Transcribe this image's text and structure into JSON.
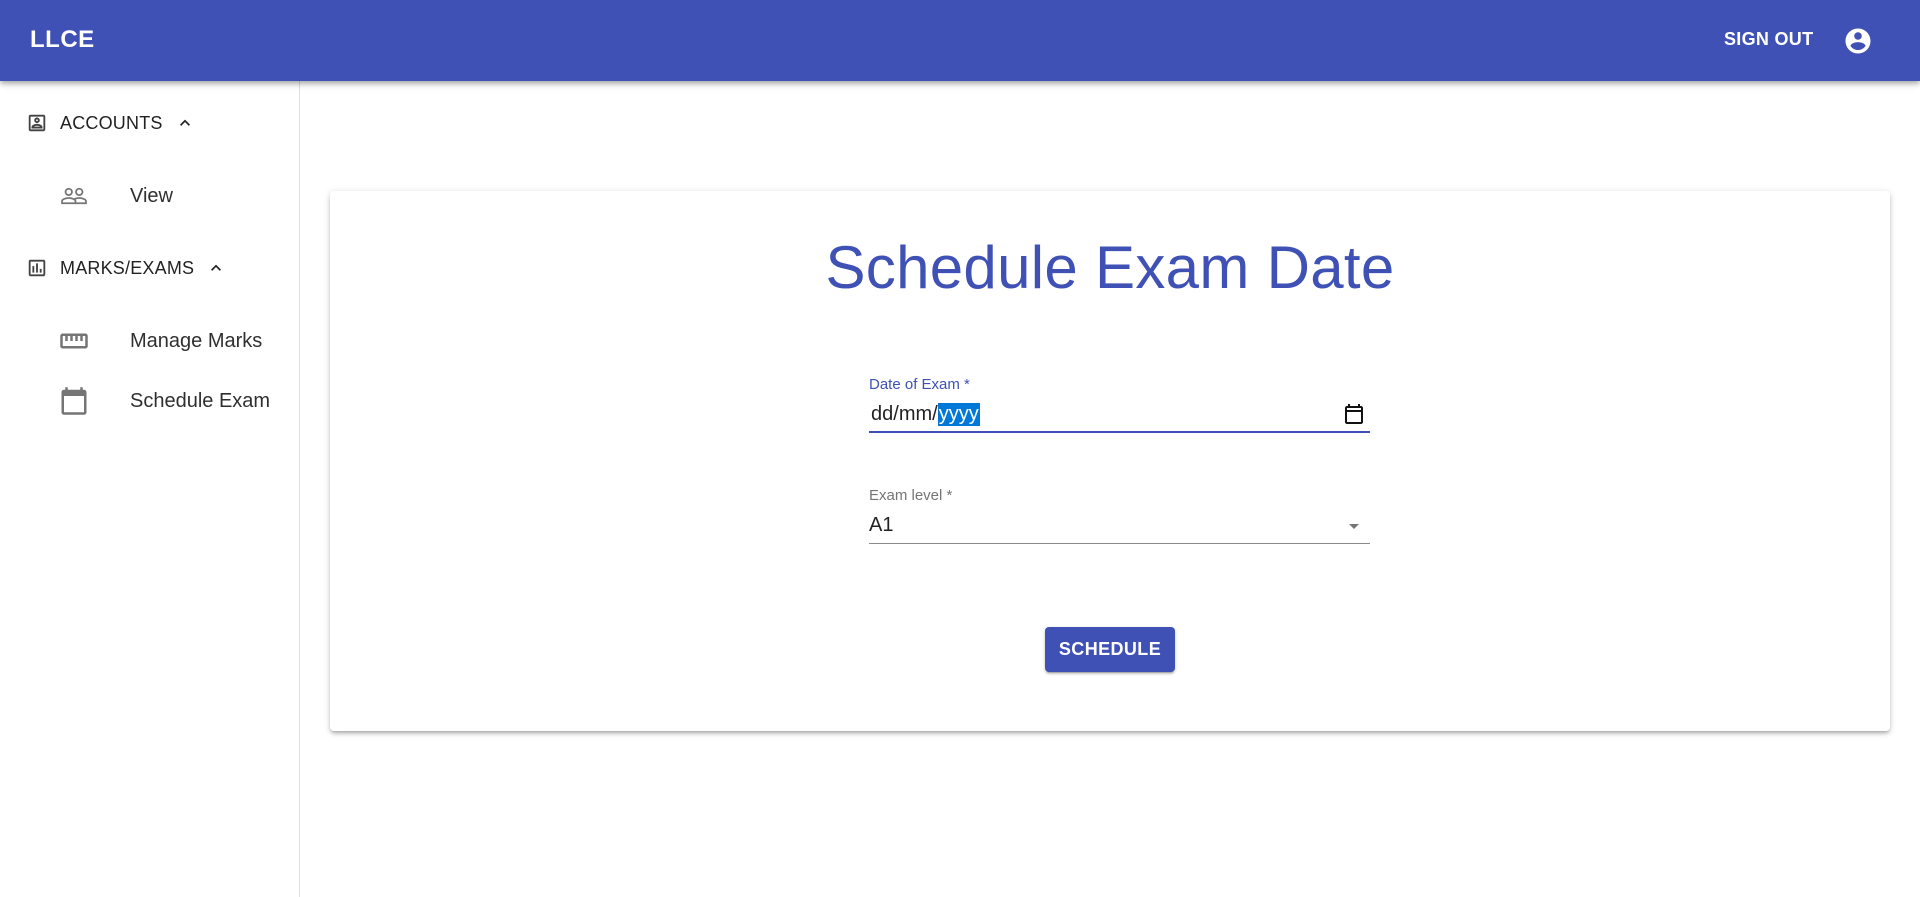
{
  "appbar": {
    "brand": "LLCE",
    "signout_label": "SIGN OUT",
    "account_icon": "account-circle-icon",
    "color": "#3f51b5"
  },
  "sidebar": {
    "sections": [
      {
        "label": "ACCOUNTS",
        "icon": "contact-card-icon",
        "expanded": true,
        "items": [
          {
            "label": "View",
            "icon": "people-icon"
          }
        ]
      },
      {
        "label": "MARKS/EXAMS",
        "icon": "bar-chart-icon",
        "expanded": true,
        "items": [
          {
            "label": "Manage Marks",
            "icon": "ruler-icon"
          },
          {
            "label": "Schedule Exam",
            "icon": "calendar-icon"
          }
        ]
      }
    ]
  },
  "form": {
    "title": "Schedule Exam Date",
    "date_field": {
      "label": "Date of Exam *",
      "day": "dd",
      "month": "mm",
      "year": "yyyy",
      "separator": "/"
    },
    "level_field": {
      "label": "Exam level *",
      "value": "A1"
    },
    "submit_label": "SCHEDULE"
  }
}
